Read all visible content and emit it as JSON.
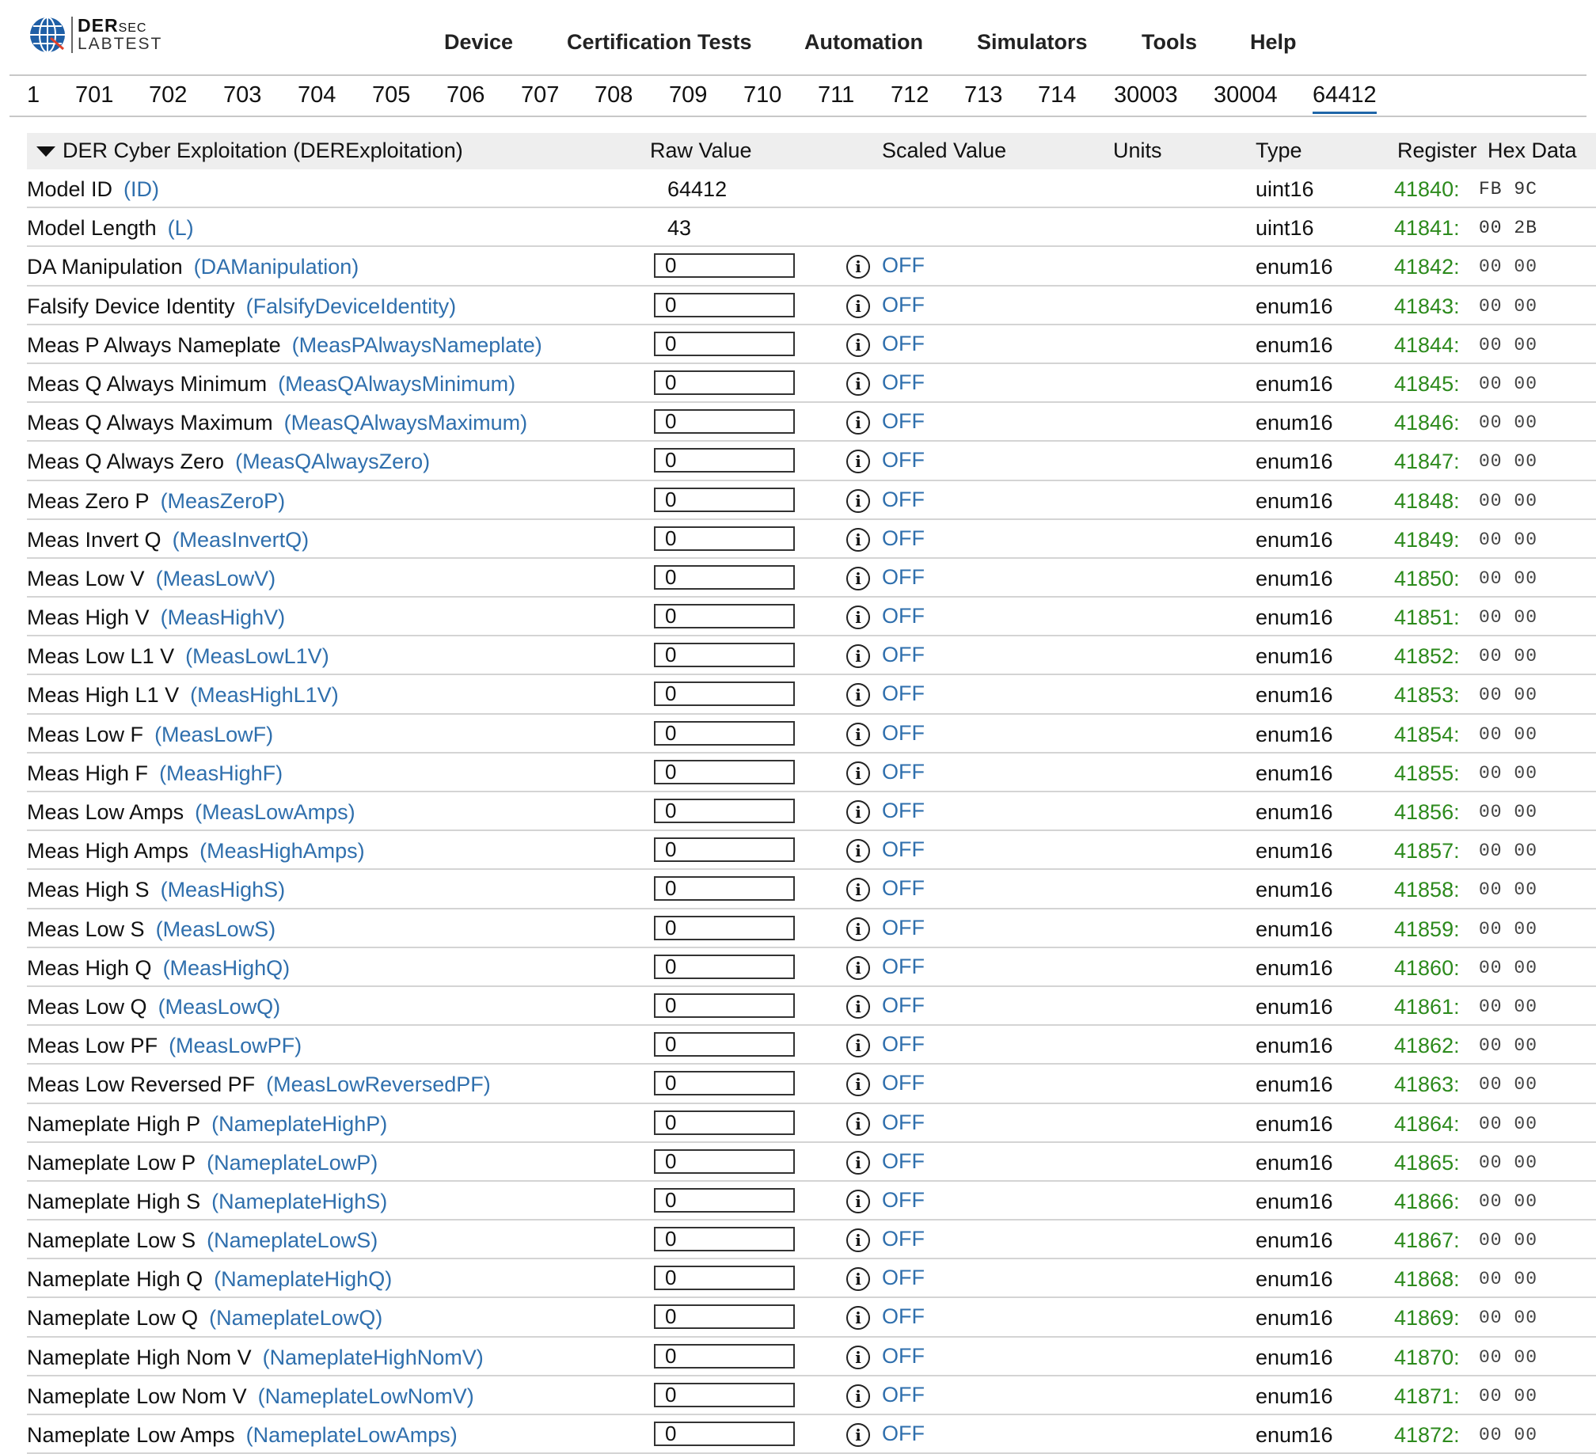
{
  "logo": {
    "line1_bold": "DER",
    "line1_light": "SEC",
    "line2": "LABTEST"
  },
  "nav": [
    "Device",
    "Certification Tests",
    "Automation",
    "Simulators",
    "Tools",
    "Help"
  ],
  "tabs": [
    "1",
    "701",
    "702",
    "703",
    "704",
    "705",
    "706",
    "707",
    "708",
    "709",
    "710",
    "711",
    "712",
    "713",
    "714",
    "30003",
    "30004",
    "64412"
  ],
  "active_tab": "64412",
  "table": {
    "title": "DER Cyber Exploitation (DERExploitation)",
    "columns": {
      "raw": "Raw Value",
      "scaled": "Scaled Value",
      "units": "Units",
      "type": "Type",
      "register": "Register",
      "hex": "Hex Data"
    },
    "rows": [
      {
        "label": "Model ID",
        "point": "(ID)",
        "raw": "64412",
        "editable": false,
        "scaled": "",
        "type": "uint16",
        "reg": "41840:",
        "hex": "FB 9C"
      },
      {
        "label": "Model Length",
        "point": "(L)",
        "raw": "43",
        "editable": false,
        "scaled": "",
        "type": "uint16",
        "reg": "41841:",
        "hex": "00 2B"
      },
      {
        "label": "DA Manipulation",
        "point": "(DAManipulation)",
        "raw": "0",
        "editable": true,
        "scaled": "OFF",
        "type": "enum16",
        "reg": "41842:",
        "hex": "00 00"
      },
      {
        "label": "Falsify Device Identity",
        "point": "(FalsifyDeviceIdentity)",
        "raw": "0",
        "editable": true,
        "scaled": "OFF",
        "type": "enum16",
        "reg": "41843:",
        "hex": "00 00"
      },
      {
        "label": "Meas P Always Nameplate",
        "point": "(MeasPAlwaysNameplate)",
        "raw": "0",
        "editable": true,
        "scaled": "OFF",
        "type": "enum16",
        "reg": "41844:",
        "hex": "00 00"
      },
      {
        "label": "Meas Q Always Minimum",
        "point": "(MeasQAlwaysMinimum)",
        "raw": "0",
        "editable": true,
        "scaled": "OFF",
        "type": "enum16",
        "reg": "41845:",
        "hex": "00 00"
      },
      {
        "label": "Meas Q Always Maximum",
        "point": "(MeasQAlwaysMaximum)",
        "raw": "0",
        "editable": true,
        "scaled": "OFF",
        "type": "enum16",
        "reg": "41846:",
        "hex": "00 00"
      },
      {
        "label": "Meas Q Always Zero",
        "point": "(MeasQAlwaysZero)",
        "raw": "0",
        "editable": true,
        "scaled": "OFF",
        "type": "enum16",
        "reg": "41847:",
        "hex": "00 00"
      },
      {
        "label": "Meas Zero P",
        "point": "(MeasZeroP)",
        "raw": "0",
        "editable": true,
        "scaled": "OFF",
        "type": "enum16",
        "reg": "41848:",
        "hex": "00 00"
      },
      {
        "label": "Meas Invert Q",
        "point": "(MeasInvertQ)",
        "raw": "0",
        "editable": true,
        "scaled": "OFF",
        "type": "enum16",
        "reg": "41849:",
        "hex": "00 00"
      },
      {
        "label": "Meas Low V",
        "point": "(MeasLowV)",
        "raw": "0",
        "editable": true,
        "scaled": "OFF",
        "type": "enum16",
        "reg": "41850:",
        "hex": "00 00"
      },
      {
        "label": "Meas High V",
        "point": "(MeasHighV)",
        "raw": "0",
        "editable": true,
        "scaled": "OFF",
        "type": "enum16",
        "reg": "41851:",
        "hex": "00 00"
      },
      {
        "label": "Meas Low L1 V",
        "point": "(MeasLowL1V)",
        "raw": "0",
        "editable": true,
        "scaled": "OFF",
        "type": "enum16",
        "reg": "41852:",
        "hex": "00 00"
      },
      {
        "label": "Meas High L1 V",
        "point": "(MeasHighL1V)",
        "raw": "0",
        "editable": true,
        "scaled": "OFF",
        "type": "enum16",
        "reg": "41853:",
        "hex": "00 00"
      },
      {
        "label": "Meas Low F",
        "point": "(MeasLowF)",
        "raw": "0",
        "editable": true,
        "scaled": "OFF",
        "type": "enum16",
        "reg": "41854:",
        "hex": "00 00"
      },
      {
        "label": "Meas High F",
        "point": "(MeasHighF)",
        "raw": "0",
        "editable": true,
        "scaled": "OFF",
        "type": "enum16",
        "reg": "41855:",
        "hex": "00 00"
      },
      {
        "label": "Meas Low Amps",
        "point": "(MeasLowAmps)",
        "raw": "0",
        "editable": true,
        "scaled": "OFF",
        "type": "enum16",
        "reg": "41856:",
        "hex": "00 00"
      },
      {
        "label": "Meas High Amps",
        "point": "(MeasHighAmps)",
        "raw": "0",
        "editable": true,
        "scaled": "OFF",
        "type": "enum16",
        "reg": "41857:",
        "hex": "00 00"
      },
      {
        "label": "Meas High S",
        "point": "(MeasHighS)",
        "raw": "0",
        "editable": true,
        "scaled": "OFF",
        "type": "enum16",
        "reg": "41858:",
        "hex": "00 00"
      },
      {
        "label": "Meas Low S",
        "point": "(MeasLowS)",
        "raw": "0",
        "editable": true,
        "scaled": "OFF",
        "type": "enum16",
        "reg": "41859:",
        "hex": "00 00"
      },
      {
        "label": "Meas High Q",
        "point": "(MeasHighQ)",
        "raw": "0",
        "editable": true,
        "scaled": "OFF",
        "type": "enum16",
        "reg": "41860:",
        "hex": "00 00"
      },
      {
        "label": "Meas Low Q",
        "point": "(MeasLowQ)",
        "raw": "0",
        "editable": true,
        "scaled": "OFF",
        "type": "enum16",
        "reg": "41861:",
        "hex": "00 00"
      },
      {
        "label": "Meas Low PF",
        "point": "(MeasLowPF)",
        "raw": "0",
        "editable": true,
        "scaled": "OFF",
        "type": "enum16",
        "reg": "41862:",
        "hex": "00 00"
      },
      {
        "label": "Meas Low Reversed PF",
        "point": "(MeasLowReversedPF)",
        "raw": "0",
        "editable": true,
        "scaled": "OFF",
        "type": "enum16",
        "reg": "41863:",
        "hex": "00 00"
      },
      {
        "label": "Nameplate High P",
        "point": "(NameplateHighP)",
        "raw": "0",
        "editable": true,
        "scaled": "OFF",
        "type": "enum16",
        "reg": "41864:",
        "hex": "00 00"
      },
      {
        "label": "Nameplate Low P",
        "point": "(NameplateLowP)",
        "raw": "0",
        "editable": true,
        "scaled": "OFF",
        "type": "enum16",
        "reg": "41865:",
        "hex": "00 00"
      },
      {
        "label": "Nameplate High S",
        "point": "(NameplateHighS)",
        "raw": "0",
        "editable": true,
        "scaled": "OFF",
        "type": "enum16",
        "reg": "41866:",
        "hex": "00 00"
      },
      {
        "label": "Nameplate Low S",
        "point": "(NameplateLowS)",
        "raw": "0",
        "editable": true,
        "scaled": "OFF",
        "type": "enum16",
        "reg": "41867:",
        "hex": "00 00"
      },
      {
        "label": "Nameplate High Q",
        "point": "(NameplateHighQ)",
        "raw": "0",
        "editable": true,
        "scaled": "OFF",
        "type": "enum16",
        "reg": "41868:",
        "hex": "00 00"
      },
      {
        "label": "Nameplate Low Q",
        "point": "(NameplateLowQ)",
        "raw": "0",
        "editable": true,
        "scaled": "OFF",
        "type": "enum16",
        "reg": "41869:",
        "hex": "00 00"
      },
      {
        "label": "Nameplate High Nom V",
        "point": "(NameplateHighNomV)",
        "raw": "0",
        "editable": true,
        "scaled": "OFF",
        "type": "enum16",
        "reg": "41870:",
        "hex": "00 00"
      },
      {
        "label": "Nameplate Low Nom V",
        "point": "(NameplateLowNomV)",
        "raw": "0",
        "editable": true,
        "scaled": "OFF",
        "type": "enum16",
        "reg": "41871:",
        "hex": "00 00"
      },
      {
        "label": "Nameplate Low Amps",
        "point": "(NameplateLowAmps)",
        "raw": "0",
        "editable": true,
        "scaled": "OFF",
        "type": "enum16",
        "reg": "41872:",
        "hex": "00 00"
      }
    ]
  },
  "colors": {
    "point_name": "#2f6fad",
    "register": "#2c8a1c",
    "active_tab": "#1f66a8"
  },
  "icons": {
    "logo": "globe-icon",
    "expand": "caret-down-icon",
    "info": "info-icon"
  }
}
